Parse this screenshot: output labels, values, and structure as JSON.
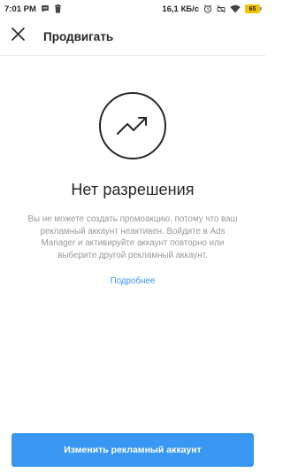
{
  "status_bar": {
    "time": "7:01 PM",
    "network_speed": "16,1 КБ/с",
    "battery_level": "65",
    "icons": [
      "chat-bubble-icon",
      "trash-icon",
      "alarm-icon",
      "silent-icon",
      "wifi-icon",
      "battery-icon"
    ]
  },
  "header": {
    "title": "Продвигать",
    "close_icon": "close-icon"
  },
  "empty_state": {
    "icon": "trending-up-icon",
    "title": "Нет разрешения",
    "description": "Вы не можете создать промоакцию, потому что ваш рекламный аккаунт неактивен. Войдите в Ads Manager и активируйте аккаунт повторно или выберите другой рекламный аккаунт.",
    "learn_more_label": "Подробнее"
  },
  "footer": {
    "button_label": "Изменить рекламный аккаунт"
  },
  "colors": {
    "accent": "#3897f0",
    "text_primary": "#262626",
    "text_secondary": "#999999",
    "battery": "#f2c200"
  }
}
